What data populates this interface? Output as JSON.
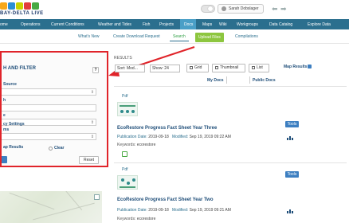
{
  "header": {
    "logo_text": "BAY-DELTA LIVE",
    "user_name": "Sarah Dobslager",
    "back_icon": "back-arrow-icon",
    "forward_icon": "forward-arrow-icon"
  },
  "main_nav": {
    "items": [
      {
        "label": "ome",
        "active": false
      },
      {
        "label": "Operations",
        "active": false
      },
      {
        "label": "Current Conditions",
        "active": false
      },
      {
        "label": "Weather and Tides",
        "active": false
      },
      {
        "label": "Fish",
        "active": false
      },
      {
        "label": "Projects",
        "active": false
      },
      {
        "label": "Docs",
        "active": true
      },
      {
        "label": "Maps",
        "active": false
      },
      {
        "label": "Wiki",
        "active": false
      },
      {
        "label": "Workgroups",
        "active": false
      },
      {
        "label": "Data Catalog",
        "active": false
      },
      {
        "label": "Explore Data",
        "active": false
      }
    ]
  },
  "sub_nav": {
    "whats_new": "What's New",
    "create_download": "Create Download Request",
    "search": "Search",
    "upload": "Upload Files",
    "compilations": "Compilations"
  },
  "filter_panel": {
    "title": "H AND FILTER",
    "help": "?",
    "labels": {
      "source": "Source",
      "h": "h",
      "blank": "e",
      "ms": "ms",
      "privacy": "cy Settings",
      "map_results": "ap Results"
    },
    "clear": "Clear",
    "reset": "Reset"
  },
  "results": {
    "label": "RESULTS",
    "sort": "Sort: Mod...",
    "show": "Show: 24",
    "view_buttons": {
      "grid": "Grid",
      "thumbnail": "Thumbnail",
      "list": "List"
    },
    "map_results": "Map Results",
    "my_docs": "My Docs",
    "public_docs": "Public Docs",
    "items": [
      {
        "type": "Pdf",
        "title": "EcoRestore Progress Fact Sheet Year Three",
        "publication_label": "Publication Date:",
        "publication_date": "2019-09-18",
        "modified_label": "Modified:",
        "modified_date": "Sep 19, 2019 09:22 AM",
        "keywords_label": "Keywords:",
        "keywords": "ecorestore",
        "tools": "Tools"
      },
      {
        "type": "Pdf",
        "title": "EcoRestore Progress Fact Sheet Year Two",
        "publication_label": "Publication Date:",
        "publication_date": "2019-09-18",
        "modified_label": "Modified:",
        "modified_date": "Sep 19, 2019 09:21 AM",
        "keywords_label": "Keywords:",
        "keywords": "ecorestore",
        "tools": "Tools"
      }
    ]
  },
  "colors": {
    "nav_bg": "#2b6f8e",
    "nav_active": "#4a9fc7",
    "upload_green": "#8dc63f",
    "annotation_red": "#e0242a",
    "title_blue": "#1f4e79"
  }
}
